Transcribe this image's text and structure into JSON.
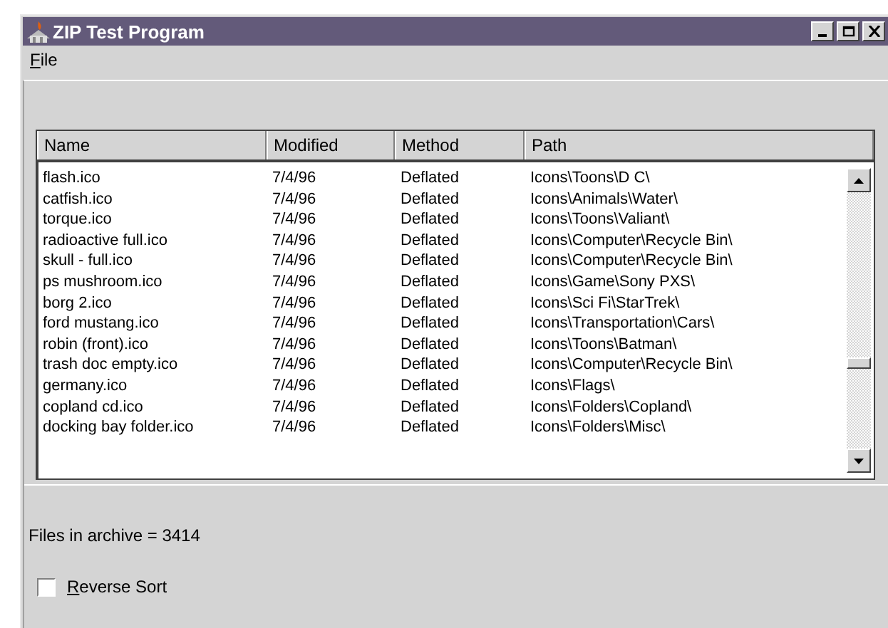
{
  "window": {
    "title": "ZIP Test Program"
  },
  "menu": [
    {
      "label": "File"
    }
  ],
  "table": {
    "columns": [
      "Name",
      "Modified",
      "Method",
      "Path"
    ],
    "rows": [
      [
        "flash.ico",
        "7/4/96",
        "Deflated",
        "Icons\\Toons\\D C\\"
      ],
      [
        "catfish.ico",
        "7/4/96",
        "Deflated",
        "Icons\\Animals\\Water\\"
      ],
      [
        "torque.ico",
        "7/4/96",
        "Deflated",
        "Icons\\Toons\\Valiant\\"
      ],
      [
        "radioactive full.ico",
        "7/4/96",
        "Deflated",
        "Icons\\Computer\\Recycle Bin\\"
      ],
      [
        "skull - full.ico",
        "7/4/96",
        "Deflated",
        "Icons\\Computer\\Recycle Bin\\"
      ],
      [
        "ps mushroom.ico",
        "7/4/96",
        "Deflated",
        "Icons\\Game\\Sony PXS\\"
      ],
      [
        "borg 2.ico",
        "7/4/96",
        "Deflated",
        "Icons\\Sci Fi\\StarTrek\\"
      ],
      [
        "ford mustang.ico",
        "7/4/96",
        "Deflated",
        "Icons\\Transportation\\Cars\\"
      ],
      [
        "robin (front).ico",
        "7/4/96",
        "Deflated",
        "Icons\\Toons\\Batman\\"
      ],
      [
        "trash doc empty.ico",
        "7/4/96",
        "Deflated",
        "Icons\\Computer\\Recycle Bin\\"
      ],
      [
        "germany.ico",
        "7/4/96",
        "Deflated",
        "Icons\\Flags\\"
      ],
      [
        "copland cd.ico",
        "7/4/96",
        "Deflated",
        "Icons\\Folders\\Copland\\"
      ],
      [
        "docking bay folder.ico",
        "7/4/96",
        "Deflated",
        "Icons\\Folders\\Misc\\"
      ]
    ]
  },
  "status": "Files in archive = 3414",
  "reverse_sort": {
    "label": "Reverse Sort",
    "checked": false
  }
}
